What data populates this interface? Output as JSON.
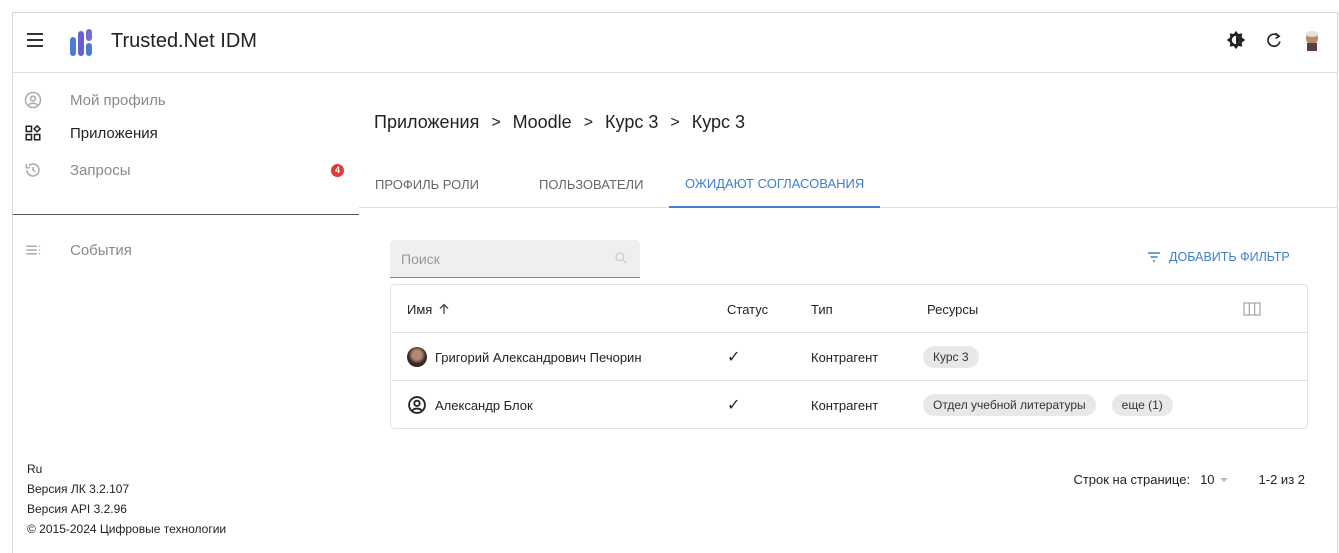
{
  "app": {
    "title": "Trusted.Net IDM"
  },
  "header": {
    "icons": [
      "theme-toggle-icon",
      "refresh-icon",
      "user-avatar"
    ]
  },
  "sidebar": {
    "items": [
      {
        "label": "Мой профиль",
        "icon": "account-circle-icon"
      },
      {
        "label": "Приложения",
        "icon": "apps-icon"
      },
      {
        "label": "Запросы",
        "icon": "history-icon",
        "badge": "4"
      },
      {
        "label": "События",
        "icon": "events-icon"
      }
    ],
    "footer": {
      "lang": "Ru",
      "version_lk": "Версия ЛК 3.2.107",
      "version_api": "Версия API 3.2.96",
      "copyright": "© 2015-2024 Цифровые технологии"
    }
  },
  "breadcrumb": [
    "Приложения",
    "Moodle",
    "Курс 3",
    "Курс 3"
  ],
  "tabs": [
    {
      "label": "ПРОФИЛЬ РОЛИ",
      "active": false
    },
    {
      "label": "ПОЛЬЗОВАТЕЛИ",
      "active": false
    },
    {
      "label": "ОЖИДАЮТ СОГЛАСОВАНИЯ",
      "active": true
    }
  ],
  "search": {
    "placeholder": "Поиск"
  },
  "filter": {
    "label": "ДОБАВИТЬ ФИЛЬТР"
  },
  "table": {
    "columns": [
      "Имя",
      "Статус",
      "Тип",
      "Ресурсы"
    ],
    "rows": [
      {
        "name": "Григорий Александрович Печорин",
        "status": "✓",
        "type": "Контрагент",
        "resources": [
          "Курс 3"
        ]
      },
      {
        "name": "Александр Блок",
        "status": "✓",
        "type": "Контрагент",
        "resources": [
          "Отдел учебной литературы",
          "еще (1)"
        ]
      }
    ]
  },
  "pagination": {
    "rows_label": "Строк на странице:",
    "rows_value": "10",
    "range": "1-2 из 2"
  },
  "colors": {
    "accent": "#3f7fcf",
    "badge": "#e53935"
  }
}
